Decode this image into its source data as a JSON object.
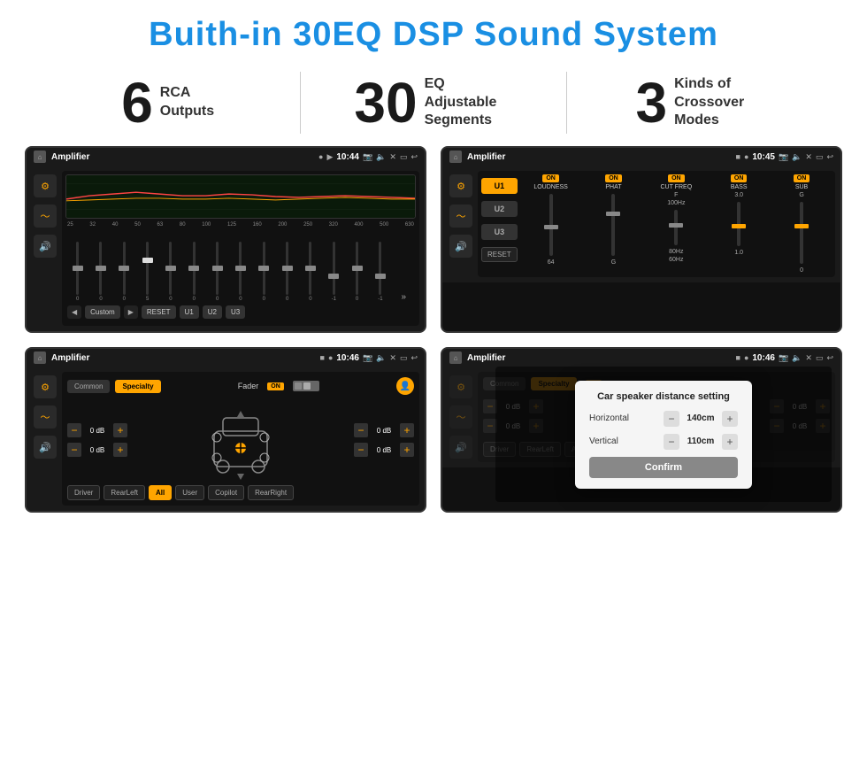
{
  "page": {
    "title": "Buith-in 30EQ DSP Sound System",
    "background_color": "#ffffff"
  },
  "stats": [
    {
      "number": "6",
      "text": "RCA\nOutputs"
    },
    {
      "number": "30",
      "text": "EQ Adjustable\nSegments"
    },
    {
      "number": "3",
      "text": "Kinds of\nCrossover Modes"
    }
  ],
  "screens": [
    {
      "id": "screen1",
      "status_bar": {
        "home": "⌂",
        "title": "Amplifier",
        "dot1": "●",
        "dot2": "▶",
        "pin": "📍",
        "time": "10:44"
      },
      "type": "eq",
      "freq_labels": [
        "25",
        "32",
        "40",
        "50",
        "63",
        "80",
        "100",
        "125",
        "160",
        "200",
        "250",
        "320",
        "400",
        "500",
        "630"
      ],
      "slider_vals": [
        "0",
        "0",
        "0",
        "5",
        "0",
        "0",
        "0",
        "0",
        "0",
        "0",
        "0",
        "-1",
        "0",
        "-1"
      ],
      "bottom_btns": [
        "◀",
        "Custom",
        "▶",
        "RESET",
        "U1",
        "U2",
        "U3"
      ]
    },
    {
      "id": "screen2",
      "status_bar": {
        "home": "⌂",
        "title": "Amplifier",
        "dot1": "■",
        "dot2": "●",
        "pin": "📍",
        "time": "10:45"
      },
      "type": "crossover",
      "u_buttons": [
        "U1",
        "U2",
        "U3"
      ],
      "controls": [
        {
          "label": "LOUDNESS",
          "on": true,
          "val": "64"
        },
        {
          "label": "PHAT",
          "on": true,
          "val": "G"
        },
        {
          "label": "CUT FREQ",
          "on": true,
          "val": "F"
        },
        {
          "label": "BASS",
          "on": true,
          "val": "3.0"
        },
        {
          "label": "SUB",
          "on": true,
          "val": "G"
        }
      ],
      "reset_label": "RESET"
    },
    {
      "id": "screen3",
      "status_bar": {
        "home": "⌂",
        "title": "Amplifier",
        "dot1": "■",
        "dot2": "●",
        "pin": "📍",
        "time": "10:46"
      },
      "type": "fader",
      "tabs": [
        "Common",
        "Specialty"
      ],
      "fader_label": "Fader",
      "on_label": "ON",
      "vol_rows": [
        {
          "val": "0 dB"
        },
        {
          "val": "0 dB"
        },
        {
          "val": "0 dB"
        },
        {
          "val": "0 dB"
        }
      ],
      "bottom_btns": [
        "Driver",
        "RearLeft",
        "All",
        "User",
        "Copilot",
        "RearRight"
      ]
    },
    {
      "id": "screen4",
      "status_bar": {
        "home": "⌂",
        "title": "Amplifier",
        "dot1": "■",
        "dot2": "●",
        "pin": "📍",
        "time": "10:46"
      },
      "type": "dialog",
      "tabs": [
        "Common",
        "Specialty"
      ],
      "dialog": {
        "title": "Car speaker distance setting",
        "rows": [
          {
            "label": "Horizontal",
            "value": "140cm"
          },
          {
            "label": "Vertical",
            "value": "110cm"
          }
        ],
        "confirm_label": "Confirm"
      },
      "bottom_btns": [
        "Driver",
        "RearLeft",
        "All",
        "User",
        "Copilot",
        "RearRight"
      ]
    }
  ]
}
